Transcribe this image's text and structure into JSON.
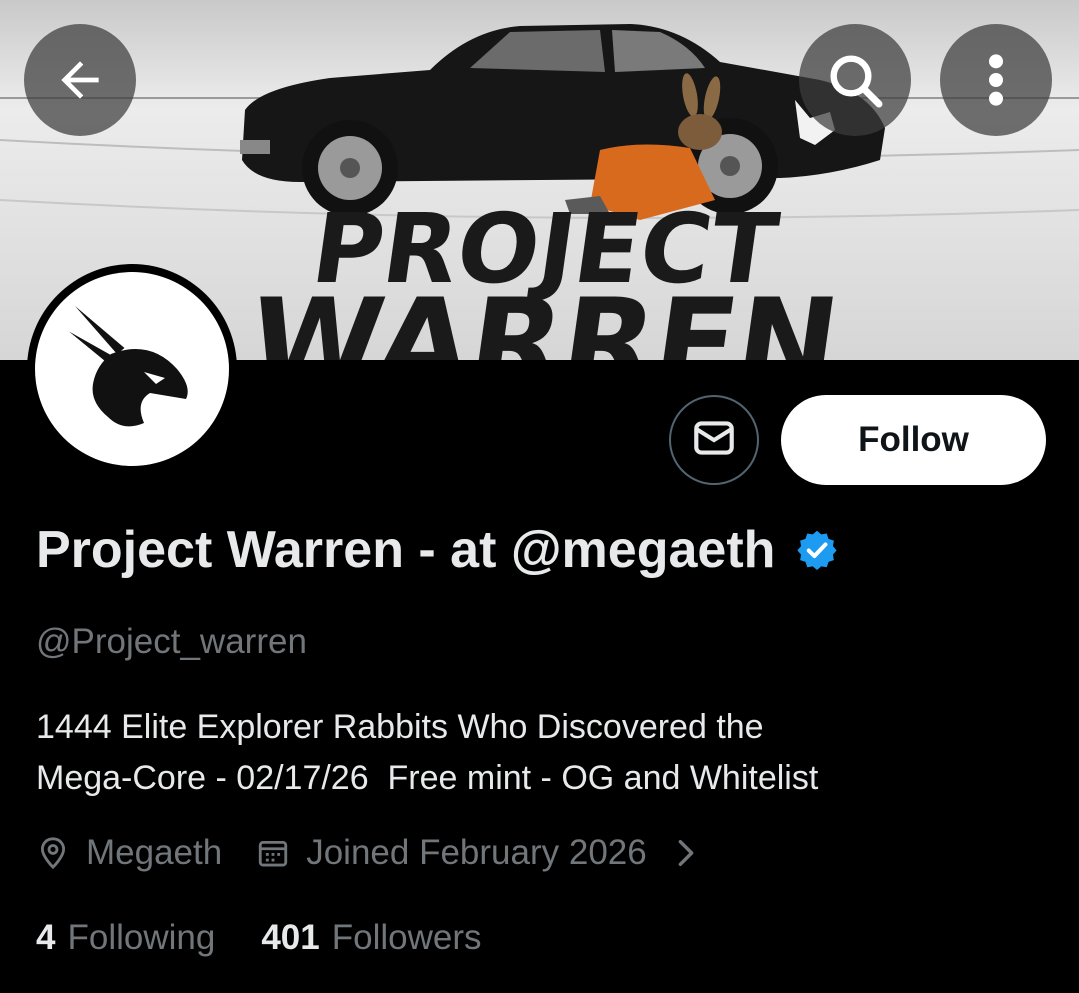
{
  "header": {
    "back_icon": "arrow-left-icon",
    "search_icon": "search-icon",
    "more_icon": "more-vertical-icon"
  },
  "banner": {
    "line1": "PROJECT",
    "line2": "WARREN"
  },
  "actions": {
    "message_icon": "envelope-icon",
    "follow_label": "Follow"
  },
  "profile": {
    "display_name": "Project Warren - at @megaeth",
    "verified_icon": "verified-badge-icon",
    "verified_color": "#1d9bf0",
    "handle": "@Project_warren",
    "bio_line1": "1444 Elite Explorer Rabbits Who Discovered the",
    "bio_line2": "Mega-Core - 02/17/26  Free mint - OG and Whitelist",
    "location": "Megaeth",
    "joined": "Joined February 2026"
  },
  "stats": {
    "following_count": "4",
    "following_label": "Following",
    "followers_count": "401",
    "followers_label": "Followers"
  }
}
